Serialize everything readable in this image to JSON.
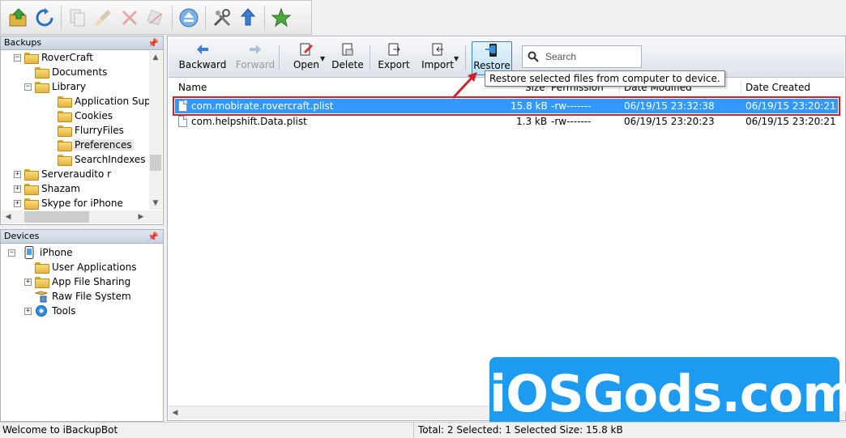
{
  "backups": {
    "header": "Backups",
    "tree": [
      {
        "label": "RoverCraft",
        "expander": "−"
      },
      {
        "label": "Documents",
        "expander": ""
      },
      {
        "label": "Library",
        "expander": "−"
      },
      {
        "label": "Application Supp",
        "expander": ""
      },
      {
        "label": "Cookies",
        "expander": ""
      },
      {
        "label": "FlurryFiles",
        "expander": ""
      },
      {
        "label": "Preferences",
        "expander": ""
      },
      {
        "label": "SearchIndexes",
        "expander": ""
      },
      {
        "label": "Serveraudito r",
        "expander": "+"
      },
      {
        "label": "Shazam",
        "expander": "+"
      },
      {
        "label": "Skype for iPhone",
        "expander": "+"
      }
    ]
  },
  "devices": {
    "header": "Devices",
    "tree": [
      {
        "label": "iPhone",
        "expander": "−"
      },
      {
        "label": "User Applications",
        "expander": ""
      },
      {
        "label": "App File Sharing",
        "expander": "+"
      },
      {
        "label": "Raw File System",
        "expander": ""
      },
      {
        "label": "Tools",
        "expander": "+"
      }
    ]
  },
  "toolbar": {
    "backward": "Backward",
    "forward": "Forward",
    "open": "Open",
    "delete": "Delete",
    "export": "Export",
    "import": "Import",
    "restore": "Restore",
    "search_placeholder": "Search"
  },
  "table": {
    "columns": {
      "name": "Name",
      "size": "Size",
      "permission": "Permission",
      "modified": "Date Modified",
      "created": "Date Created"
    },
    "rows": [
      {
        "name": "com.mobirate.rovercraft.plist",
        "size": "15.8 kB",
        "permission": "-rw-------",
        "modified": "06/19/15 23:32:38",
        "created": "06/19/15 23:20:21"
      },
      {
        "name": "com.helpshift.Data.plist",
        "size": "1.3 kB",
        "permission": "-rw-------",
        "modified": "06/19/15 23:20:23",
        "created": "06/19/15 23:20:21"
      }
    ]
  },
  "tooltip": "Restore selected files from computer to device.",
  "status": {
    "left": "Welcome to iBackupBot",
    "right": "Total: 2 Selected: 1 Selected Size: 15.8 kB"
  },
  "watermark": "iOSGods.com",
  "colors": {
    "selection": "#3399ff",
    "highlight_border": "#c8242b",
    "watermark_bg": "#1d9bf0"
  }
}
